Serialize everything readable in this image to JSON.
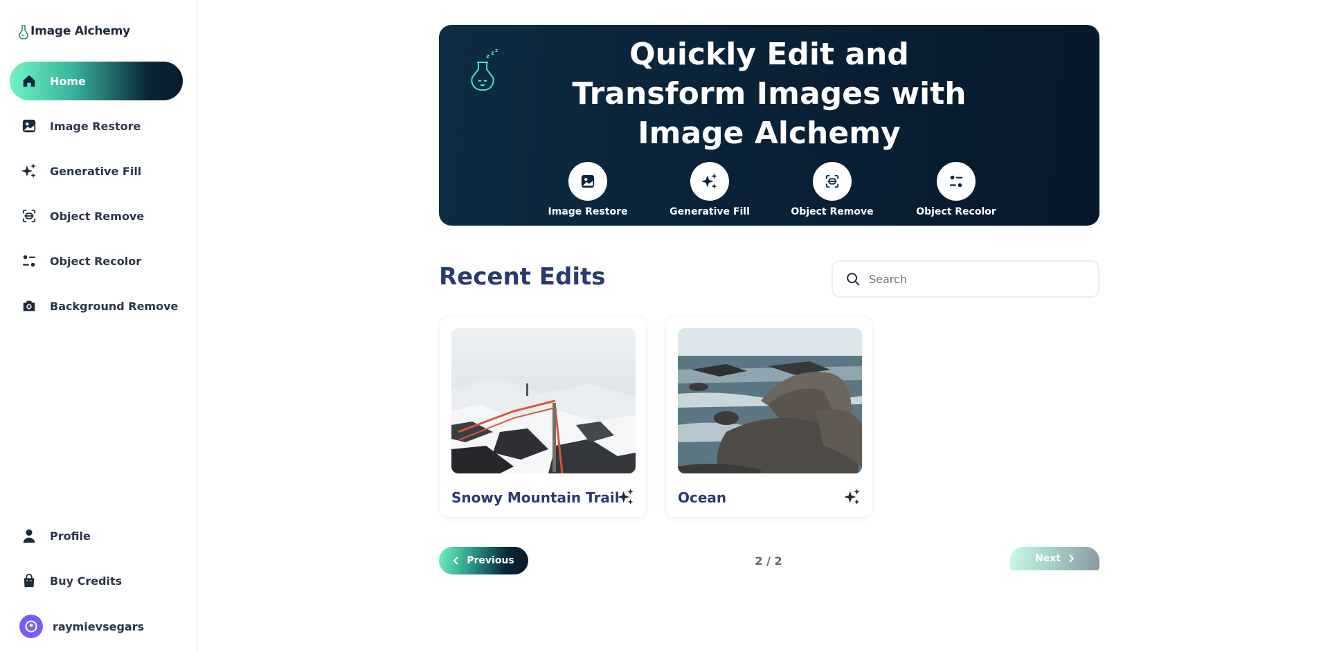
{
  "app": {
    "name": "Image Alchemy"
  },
  "sidebar": {
    "items": [
      {
        "label": "Home",
        "icon": "home-icon",
        "active": true
      },
      {
        "label": "Image Restore",
        "icon": "image-icon"
      },
      {
        "label": "Generative Fill",
        "icon": "sparkles-icon"
      },
      {
        "label": "Object Remove",
        "icon": "scan-icon"
      },
      {
        "label": "Object Recolor",
        "icon": "filter-icon"
      },
      {
        "label": "Background Remove",
        "icon": "camera-icon"
      }
    ],
    "bottom": [
      {
        "label": "Profile",
        "icon": "user-icon"
      },
      {
        "label": "Buy Credits",
        "icon": "bag-icon"
      }
    ],
    "user": {
      "name": "raymievsegars"
    }
  },
  "hero": {
    "title_lines": [
      "Quickly Edit and",
      "Transform Images with",
      "Image Alchemy"
    ],
    "actions": [
      {
        "label": "Image Restore",
        "icon": "image-icon"
      },
      {
        "label": "Generative Fill",
        "icon": "sparkles-icon"
      },
      {
        "label": "Object Remove",
        "icon": "scan-icon"
      },
      {
        "label": "Object Recolor",
        "icon": "filter-icon"
      }
    ]
  },
  "recent": {
    "title": "Recent Edits",
    "search_placeholder": "Search",
    "cards": [
      {
        "title": "Snowy Mountain Trail",
        "icon": "sparkles-icon"
      },
      {
        "title": "Ocean",
        "icon": "sparkles-icon"
      }
    ]
  },
  "pagination": {
    "prev": "Previous",
    "next": "Next",
    "page": "2 / 2"
  },
  "colors": {
    "accent": "#6ff3c6",
    "navy": "#0a2237",
    "title": "#2b3a6e"
  }
}
